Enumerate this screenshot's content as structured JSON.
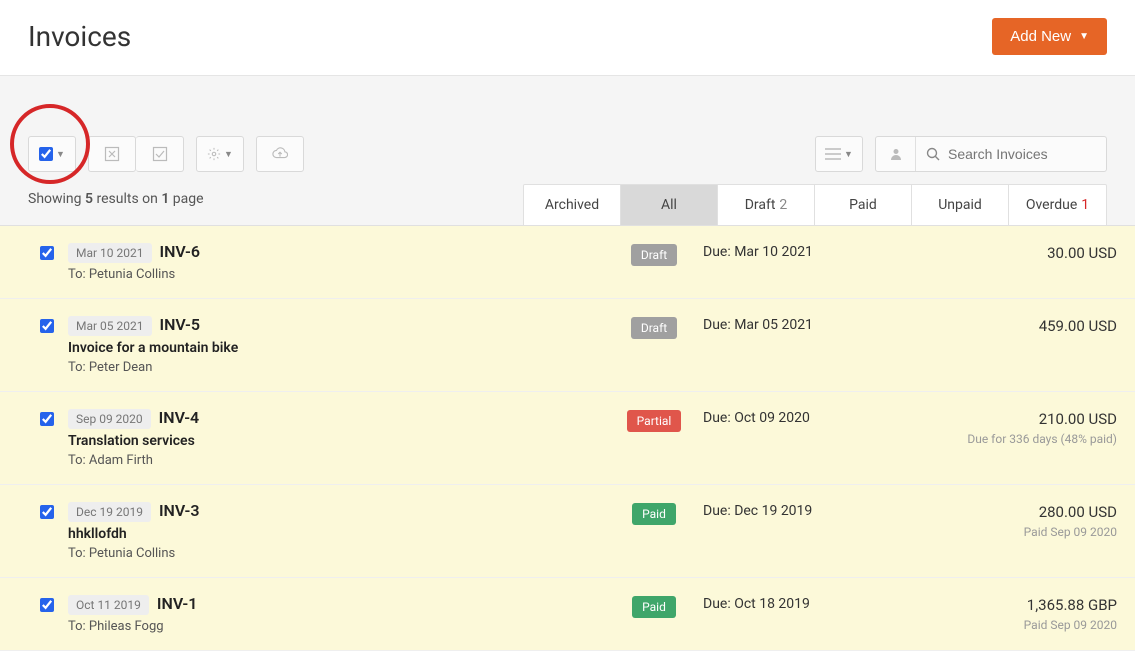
{
  "header": {
    "title": "Invoices",
    "add_new": "Add New"
  },
  "search": {
    "placeholder": "Search Invoices"
  },
  "results": {
    "prefix": "Showing ",
    "count": "5",
    "mid": " results on ",
    "pages": "1",
    "suffix": " page"
  },
  "tabs": [
    {
      "label": "Archived",
      "count": ""
    },
    {
      "label": "All",
      "count": "",
      "active": true
    },
    {
      "label": "Draft",
      "count": "2"
    },
    {
      "label": "Paid",
      "count": ""
    },
    {
      "label": "Unpaid",
      "count": ""
    },
    {
      "label": "Overdue",
      "count": "1",
      "count_red": true
    }
  ],
  "invoices": [
    {
      "selected": true,
      "date": "Mar 10 2021",
      "num": "INV-6",
      "subject": "",
      "to": "To: Petunia Collins",
      "status": "Draft",
      "status_class": "draft",
      "due": "Due: Mar 10 2021",
      "amount": "30.00 USD",
      "amount_sub": ""
    },
    {
      "selected": true,
      "date": "Mar 05 2021",
      "num": "INV-5",
      "subject": "Invoice for a mountain bike",
      "to": "To: Peter Dean",
      "status": "Draft",
      "status_class": "draft",
      "due": "Due: Mar 05 2021",
      "amount": "459.00 USD",
      "amount_sub": ""
    },
    {
      "selected": true,
      "date": "Sep 09 2020",
      "num": "INV-4",
      "subject": "Translation services",
      "to": "To: Adam Firth",
      "status": "Partial",
      "status_class": "partial",
      "due": "Due: Oct 09 2020",
      "amount": "210.00 USD",
      "amount_sub": "Due for 336 days (48% paid)"
    },
    {
      "selected": true,
      "date": "Dec 19 2019",
      "num": "INV-3",
      "subject": "hhkllofdh",
      "to": "To: Petunia Collins",
      "status": "Paid",
      "status_class": "paid",
      "due": "Due: Dec 19 2019",
      "amount": "280.00 USD",
      "amount_sub": "Paid Sep 09 2020"
    },
    {
      "selected": true,
      "date": "Oct 11 2019",
      "num": "INV-1",
      "subject": "",
      "to": "To: Phileas Fogg",
      "status": "Paid",
      "status_class": "paid",
      "due": "Due: Oct 18 2019",
      "amount": "1,365.88 GBP",
      "amount_sub": "Paid Sep 09 2020"
    }
  ]
}
